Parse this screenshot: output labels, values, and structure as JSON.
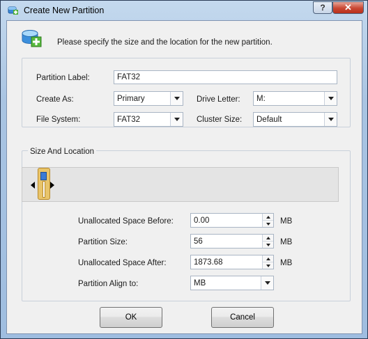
{
  "window": {
    "title": "Create New Partition",
    "help_label": "?",
    "close_label": "✕"
  },
  "header": {
    "instruction": "Please specify the size and the location for the new partition."
  },
  "properties": {
    "partition_label_caption": "Partition Label:",
    "partition_label_value": "FAT32",
    "create_as_caption": "Create As:",
    "create_as_value": "Primary",
    "drive_letter_caption": "Drive Letter:",
    "drive_letter_value": "M:",
    "file_system_caption": "File System:",
    "file_system_value": "FAT32",
    "cluster_size_caption": "Cluster Size:",
    "cluster_size_value": "Default"
  },
  "size_location": {
    "group_title": "Size And Location",
    "unallocated_before_caption": "Unallocated Space Before:",
    "unallocated_before_value": "0.00",
    "partition_size_caption": "Partition Size:",
    "partition_size_value": "56",
    "unallocated_after_caption": "Unallocated Space After:",
    "unallocated_after_value": "1873.68",
    "align_caption": "Partition Align to:",
    "align_value": "MB",
    "unit": "MB"
  },
  "buttons": {
    "ok_label": "OK",
    "cancel_label": "Cancel"
  },
  "colors": {
    "accent": "#3a7bd5",
    "handle": "#e8c46a"
  }
}
